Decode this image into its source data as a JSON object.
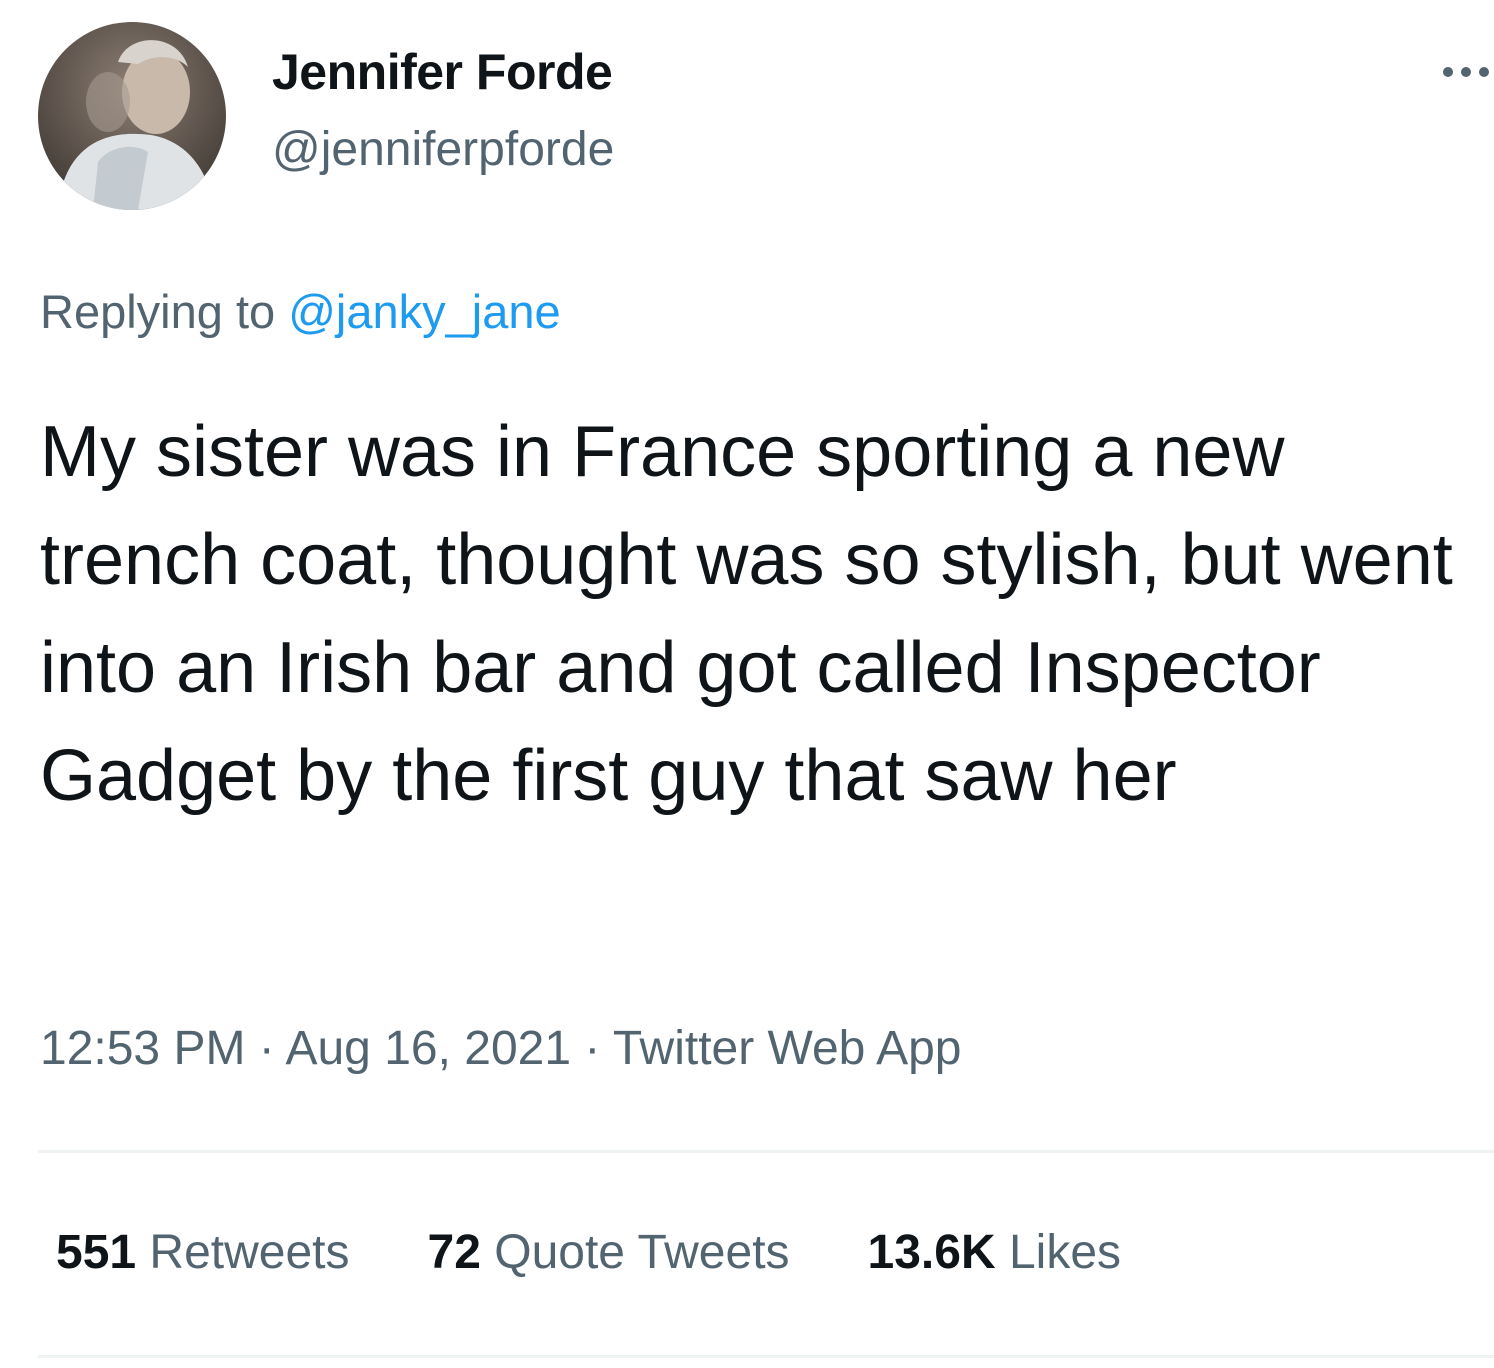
{
  "user": {
    "display_name": "Jennifer Forde",
    "handle": "@jenniferpforde"
  },
  "reply": {
    "prefix": "Replying to ",
    "mention": "@janky_jane"
  },
  "tweet": {
    "text": "My sister was in France sporting a new trench coat, thought was so stylish, but went into an Irish bar and got called Inspector Gadget by the first guy that saw her"
  },
  "meta": {
    "time": "12:53 PM",
    "separator": " · ",
    "date": "Aug 16, 2021",
    "source": "Twitter Web App"
  },
  "stats": {
    "retweets": {
      "count": "551",
      "label": " Retweets"
    },
    "quote_tweets": {
      "count": "72",
      "label": " Quote Tweets"
    },
    "likes": {
      "count": "13.6K",
      "label": " Likes"
    }
  },
  "icons": {
    "avatar": "profile-photo",
    "more": "more-options-icon"
  },
  "colors": {
    "text_primary": "#0f1419",
    "text_secondary": "#536471",
    "link": "#1d9bf0",
    "divider": "#eff3f4"
  }
}
